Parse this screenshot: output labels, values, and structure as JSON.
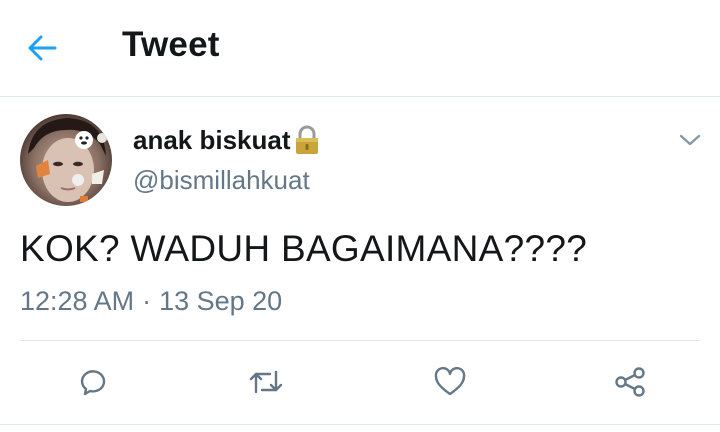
{
  "header": {
    "title": "Tweet",
    "back_icon": "back-arrow-icon",
    "accent_color": "#1da1f2"
  },
  "tweet": {
    "author": {
      "display_name": "anak biskuat",
      "username": "@bismillahkuat",
      "protected_icon": "lock-icon"
    },
    "text": "KOK? WADUH BAGAIMANA????",
    "time": "12:28 AM",
    "separator": "·",
    "date": "13 Sep 20"
  },
  "actions": [
    {
      "name": "reply",
      "icon": "reply-icon"
    },
    {
      "name": "retweet",
      "icon": "retweet-icon"
    },
    {
      "name": "like",
      "icon": "heart-icon"
    },
    {
      "name": "share",
      "icon": "share-icon"
    }
  ],
  "colors": {
    "text_primary": "#14171a",
    "text_secondary": "#657786",
    "border": "#e1e8ed",
    "icon_gray": "#657786"
  }
}
